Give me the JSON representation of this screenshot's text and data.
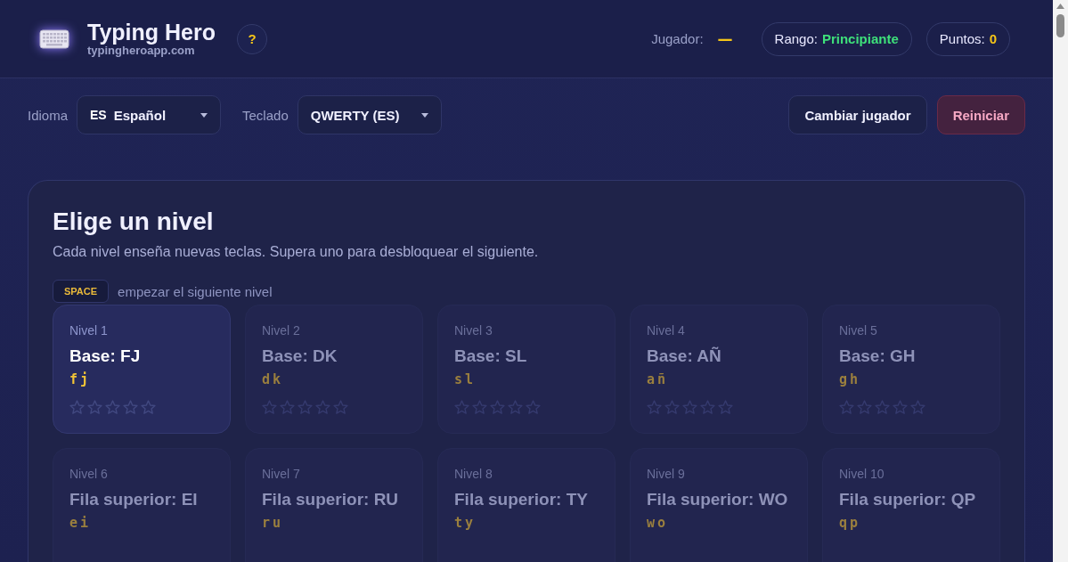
{
  "header": {
    "title": "Typing Hero",
    "subtitle": "typingheroapp.com",
    "help": "?",
    "player_label": "Jugador:",
    "player_value": "—",
    "rank_label": "Rango:",
    "rank_value": "Principiante",
    "points_label": "Puntos:",
    "points_value": "0"
  },
  "toolbar": {
    "language_label": "Idioma",
    "language_flag": "ES",
    "language_value": "Español",
    "keyboard_label": "Teclado",
    "keyboard_value": "QWERTY (ES)",
    "buttons": [
      {
        "label": "Cambiar jugador",
        "kind": "neutral"
      },
      {
        "label": "Reiniciar",
        "kind": "danger"
      }
    ]
  },
  "levels_panel": {
    "title": "Elige un nivel",
    "description": "Cada nivel enseña nuevas teclas. Supera uno para desbloquear el siguiente.",
    "hint_key": "SPACE",
    "hint_text": "empezar el siguiente nivel",
    "levels": [
      {
        "number": "Nivel 1",
        "name": "Base: FJ",
        "keys": "fj",
        "locked": false,
        "stars": 0
      },
      {
        "number": "Nivel 2",
        "name": "Base: DK",
        "keys": "dk",
        "locked": true,
        "stars": 0
      },
      {
        "number": "Nivel 3",
        "name": "Base: SL",
        "keys": "sl",
        "locked": true,
        "stars": 0
      },
      {
        "number": "Nivel 4",
        "name": "Base: AÑ",
        "keys": "añ",
        "locked": true,
        "stars": 0
      },
      {
        "number": "Nivel 5",
        "name": "Base: GH",
        "keys": "gh",
        "locked": true,
        "stars": 0
      },
      {
        "number": "Nivel 6",
        "name": "Fila superior: EI",
        "keys": "ei",
        "locked": true
      },
      {
        "number": "Nivel 7",
        "name": "Fila superior: RU",
        "keys": "ru",
        "locked": true
      },
      {
        "number": "Nivel 8",
        "name": "Fila superior: TY",
        "keys": "ty",
        "locked": true
      },
      {
        "number": "Nivel 9",
        "name": "Fila superior: WO",
        "keys": "wo",
        "locked": true
      },
      {
        "number": "Nivel 10",
        "name": "Fila superior: QP",
        "keys": "qp",
        "locked": true
      }
    ]
  }
}
